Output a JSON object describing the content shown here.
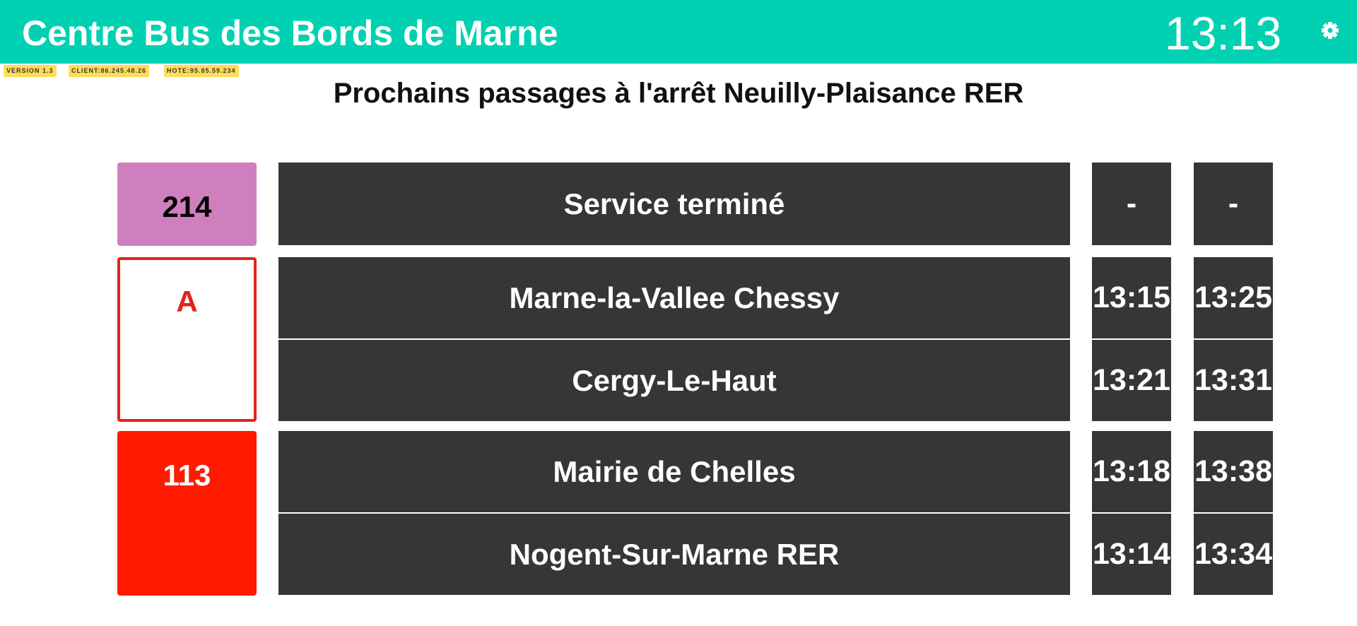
{
  "header": {
    "title": "Centre Bus des Bords de Marne",
    "clock": "13:13",
    "settings_icon": "gear-icon"
  },
  "tags": {
    "version": "VERSION 1.3",
    "client": "CLIENT:86.245.48.26",
    "host": "HOTE:95.85.59.234"
  },
  "stop": {
    "title": "Prochains passages à l'arrêt Neuilly-Plaisance RER"
  },
  "lines": [
    {
      "number": "214",
      "colors": {
        "background": "#d07fbe",
        "text": "#000000",
        "border": "#d07fbe"
      },
      "rows": [
        {
          "destination": "Service terminé",
          "next": "-",
          "following": "-"
        }
      ]
    },
    {
      "number": "A",
      "colors": {
        "background": "#ffffff",
        "text": "#e2231a",
        "border": "#e2231a"
      },
      "rows": [
        {
          "destination": "Marne-la-Vallee Chessy",
          "next": "13:15",
          "following": "13:25"
        },
        {
          "destination": "Cergy-Le-Haut",
          "next": "13:21",
          "following": "13:31"
        }
      ]
    },
    {
      "number": "113",
      "colors": {
        "background": "#ff1a00",
        "text": "#ffffff",
        "border": "#ff1a00"
      },
      "rows": [
        {
          "destination": "Mairie de Chelles",
          "next": "13:18",
          "following": "13:38"
        },
        {
          "destination": "Nogent-Sur-Marne RER",
          "next": "13:14",
          "following": "13:34"
        }
      ]
    }
  ],
  "colors": {
    "header_background": "#00d1b2",
    "cell_background": "#363636",
    "tag_background": "#ffdd57"
  }
}
